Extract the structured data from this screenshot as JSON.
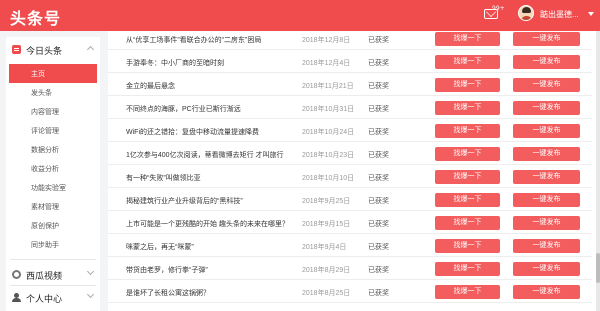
{
  "app": {
    "title": "头条号"
  },
  "header": {
    "mail_badge": "99+",
    "user_name": "踮出墨德..."
  },
  "sidebar": {
    "sections": [
      {
        "label": "今日头条",
        "icon": "toutiao-logo-icon",
        "expanded": true
      },
      {
        "label": "西瓜视频",
        "icon": "xigua-video-icon",
        "expanded": false
      },
      {
        "label": "个人中心",
        "icon": "user-profile-icon",
        "expanded": false
      }
    ],
    "items": [
      {
        "label": "主页",
        "active": true
      },
      {
        "label": "发头条",
        "active": false
      },
      {
        "label": "内容管理",
        "active": false
      },
      {
        "label": "评论管理",
        "active": false
      },
      {
        "label": "数据分析",
        "active": false
      },
      {
        "label": "收益分析",
        "active": false
      },
      {
        "label": "功能实验室",
        "active": false
      },
      {
        "label": "素材管理",
        "active": false
      },
      {
        "label": "原创保护",
        "active": false
      },
      {
        "label": "同步助手",
        "active": false
      }
    ]
  },
  "articles": [
    {
      "title": "从“优享工场事件”看联合办公的“二房东”困局",
      "date": "2018年12月8日",
      "status": "已获奖",
      "boost": "找爆一下",
      "publish": "一键发布"
    },
    {
      "title": "手游奉冬：中小厂商的至暗时刻",
      "date": "2018年12月4日",
      "status": "已获奖",
      "boost": "找爆一下",
      "publish": "一键发布"
    },
    {
      "title": "金立的最后悬念",
      "date": "2018年11月21日",
      "status": "已获奖",
      "boost": "找爆一下",
      "publish": "一键发布"
    },
    {
      "title": "不同终点的海豚，PC行业已斯行渐远",
      "date": "2018年10月31日",
      "status": "已获奖",
      "boost": "找爆一下",
      "publish": "一键发布"
    },
    {
      "title": "WiFi的还之错拾：复盘中移动流量提速降费",
      "date": "2018年10月24日",
      "status": "已获奖",
      "boost": "找爆一下",
      "publish": "一键发布"
    },
    {
      "title": "1亿次参与400亿次阅读，蒂看微博去矩行 才叫旅行",
      "date": "2018年10月23日",
      "status": "已获奖",
      "boost": "找爆一下",
      "publish": "一键发布"
    },
    {
      "title": "有一种“失败”叫做领比亚",
      "date": "2018年10月10日",
      "status": "已获奖",
      "boost": "找爆一下",
      "publish": "一键发布"
    },
    {
      "title": "揭秘建筑行业产业升级背后的“黑科技”",
      "date": "2018年9月25日",
      "status": "已获奖",
      "boost": "找爆一下",
      "publish": "一键发布"
    },
    {
      "title": "上市可能是一个更残酷的开始 趣头条的未来在哪里？",
      "date": "2018年9月15日",
      "status": "已获奖",
      "boost": "找爆一下",
      "publish": "一键发布"
    },
    {
      "title": "咪蒙之后，再无“咪蒙”",
      "date": "2018年9月4日",
      "status": "已获奖",
      "boost": "找爆一下",
      "publish": "一键发布"
    },
    {
      "title": "带货由老罗，修行拳“子弹”",
      "date": "2018年8月29日",
      "status": "已获奖",
      "boost": "找爆一下",
      "publish": "一键发布"
    },
    {
      "title": "是谁坏了长租公寓这锅粥？",
      "date": "2018年8月25日",
      "status": "已获奖",
      "boost": "找爆一下",
      "publish": "一键发布"
    }
  ],
  "colors": {
    "brand": "#f04c4e",
    "button": "#f35d5e",
    "background": "#f3f4f6"
  }
}
